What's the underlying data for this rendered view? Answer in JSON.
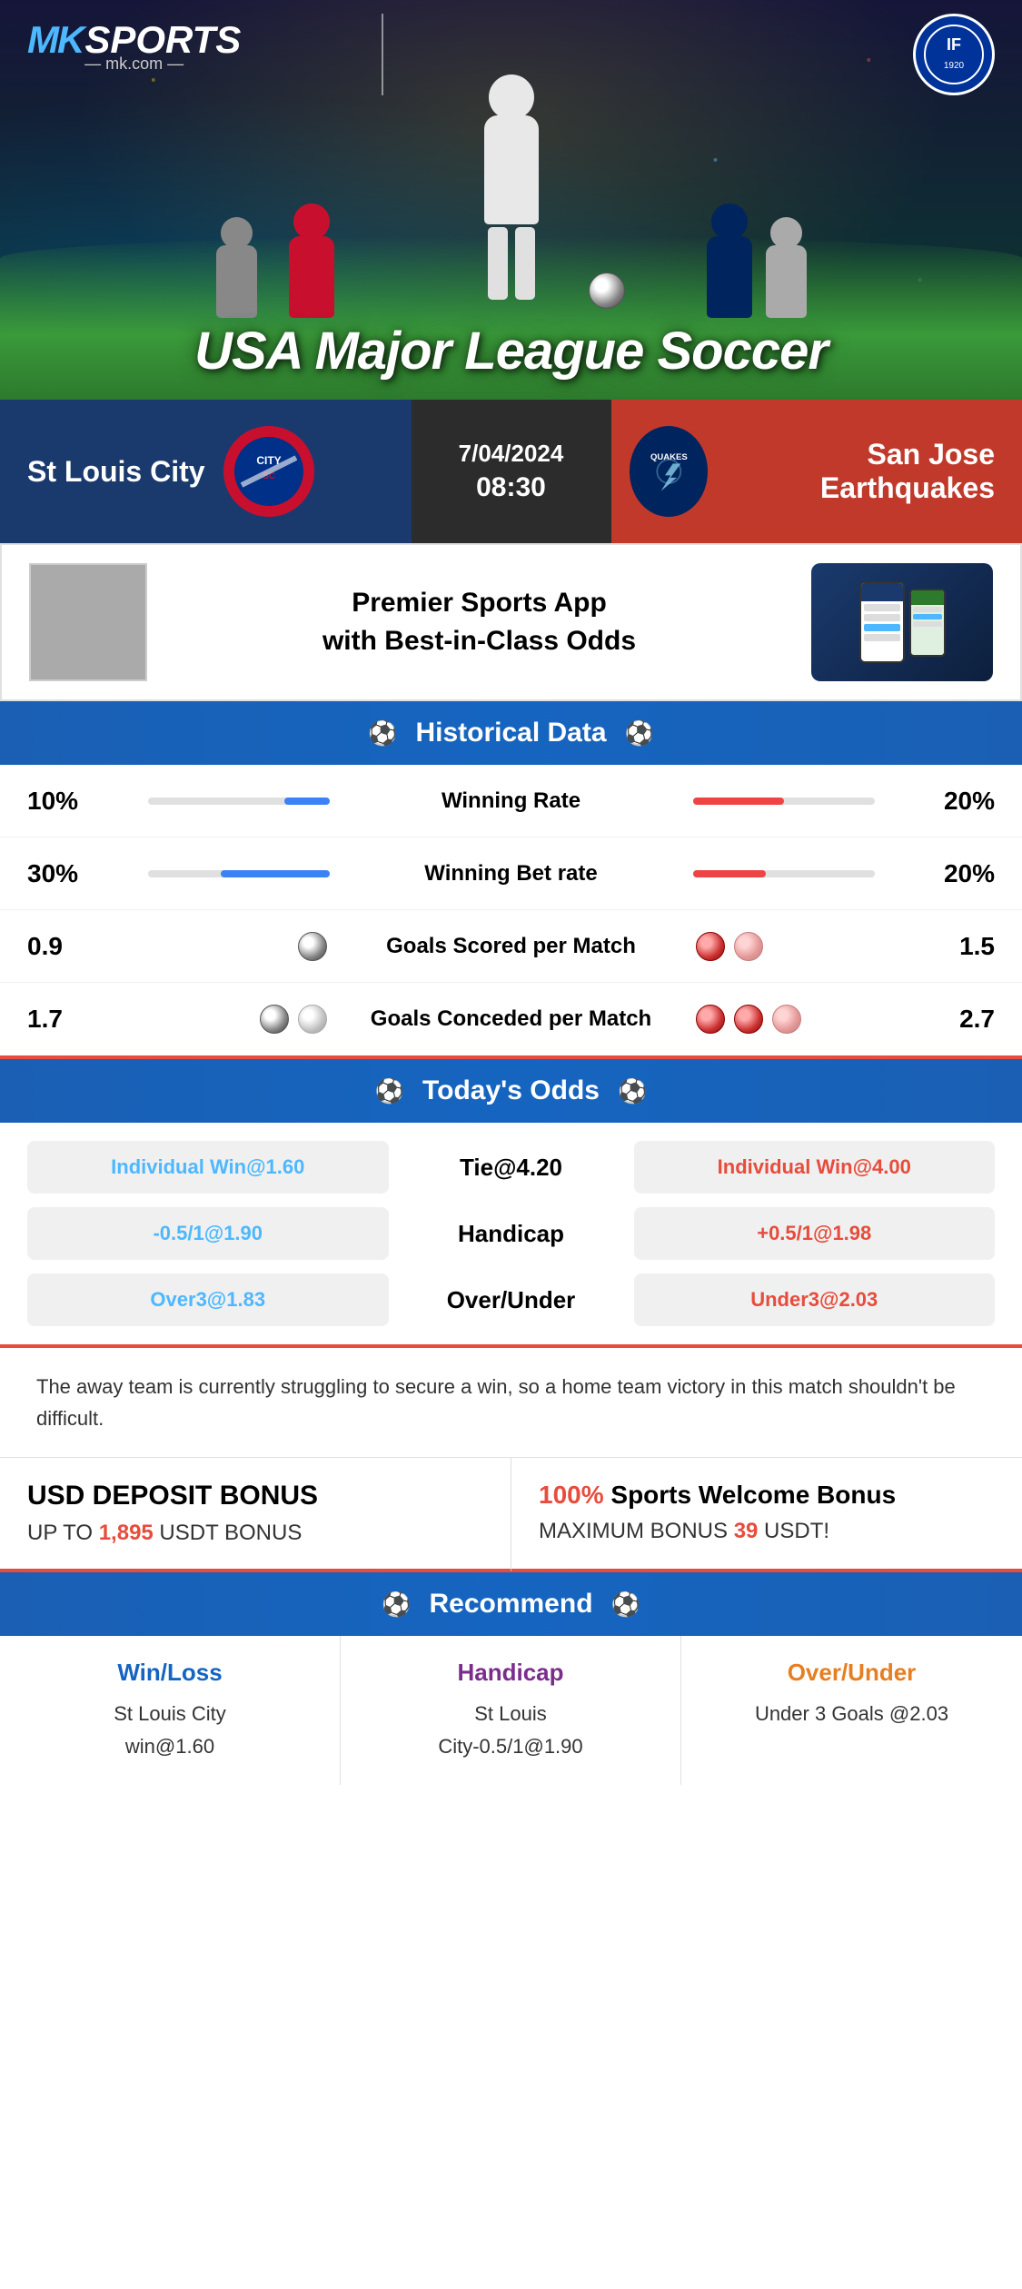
{
  "brand": {
    "name_mk": "MK",
    "name_sports": "SPORTS",
    "domain": "— mk.com —",
    "empoli_text": "IF"
  },
  "hero": {
    "title": "USA Major League Soccer"
  },
  "match": {
    "date": "7/04/2024",
    "time": "08:30",
    "team_left": "St Louis City",
    "team_right": "San Jose Earthquakes",
    "team_right_short": "QUAKES"
  },
  "app_promo": {
    "text": "Premier Sports App\nwith Best-in-Class Odds"
  },
  "historical": {
    "header": "Historical Data",
    "rows": [
      {
        "label": "Winning Rate",
        "left_val": "10%",
        "right_val": "20%",
        "left_bar_pct": 25,
        "right_bar_pct": 50
      },
      {
        "label": "Winning Bet rate",
        "left_val": "30%",
        "right_val": "20%",
        "left_bar_pct": 60,
        "right_bar_pct": 40
      },
      {
        "label": "Goals Scored per Match",
        "left_val": "0.9",
        "right_val": "1.5",
        "left_balls": 1,
        "right_balls": 2
      },
      {
        "label": "Goals Conceded per Match",
        "left_val": "1.7",
        "right_val": "2.7",
        "left_balls": 2,
        "right_balls": 3
      }
    ]
  },
  "odds": {
    "header": "Today's Odds",
    "rows": [
      {
        "left": "Individual Win@1.60",
        "center": "Tie@4.20",
        "right": "Individual Win@4.00"
      },
      {
        "left": "-0.5/1@1.90",
        "center": "Handicap",
        "right": "+0.5/1@1.98"
      },
      {
        "left": "Over3@1.83",
        "center": "Over/Under",
        "right": "Under3@2.03"
      }
    ]
  },
  "analysis": {
    "text": "The away team is currently struggling to secure a win, so a home team victory in this match shouldn't be difficult."
  },
  "bonus": {
    "left_title": "USD DEPOSIT BONUS",
    "left_sub_prefix": "UP TO ",
    "left_highlight": "1,895",
    "left_sub_suffix": " USDT BONUS",
    "right_prefix": "100%",
    "right_title": " Sports Welcome Bonus",
    "right_sub_prefix": "MAXIMUM BONUS ",
    "right_highlight": "39",
    "right_sub_suffix": " USDT!"
  },
  "recommend": {
    "header": "Recommend",
    "cells": [
      {
        "type": "Win/Loss",
        "detail_line1": "St Louis City",
        "detail_line2": "win@1.60"
      },
      {
        "type": "Handicap",
        "detail_line1": "St Louis",
        "detail_line2": "City-0.5/1@1.90"
      },
      {
        "type": "Over/Under",
        "detail_line1": "Under 3 Goals @2.03",
        "detail_line2": ""
      }
    ]
  }
}
